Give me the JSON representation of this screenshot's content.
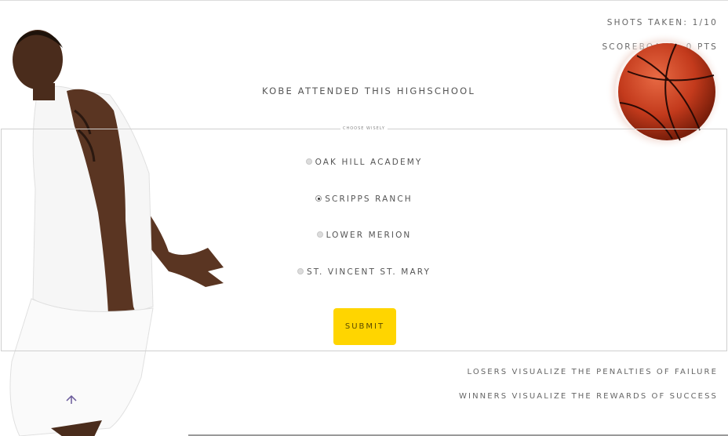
{
  "stats": {
    "shots_taken": "SHOTS TAKEN: 1/10",
    "scoreboard": "SCOREBOARD: 0 PTS"
  },
  "question": "KOBE ATTENDED THIS HIGHSCHOOL",
  "hint": "CHOOSE WISELY",
  "options": [
    {
      "label": "OAK HILL ACADEMY",
      "selected": false
    },
    {
      "label": "SCRIPPS RANCH",
      "selected": true
    },
    {
      "label": "LOWER MERION",
      "selected": false
    },
    {
      "label": "ST. VINCENT ST. MARY",
      "selected": false
    }
  ],
  "submit_label": "SUBMIT",
  "mottos": {
    "line1": "LOSERS VISUALIZE THE PENALTIES OF FAILURE",
    "line2": "WINNERS VISUALIZE THE REWARDS OF SUCCESS"
  },
  "colors": {
    "accent": "#ffd500",
    "ball": "#c9391c",
    "text": "#5a5a5a"
  }
}
